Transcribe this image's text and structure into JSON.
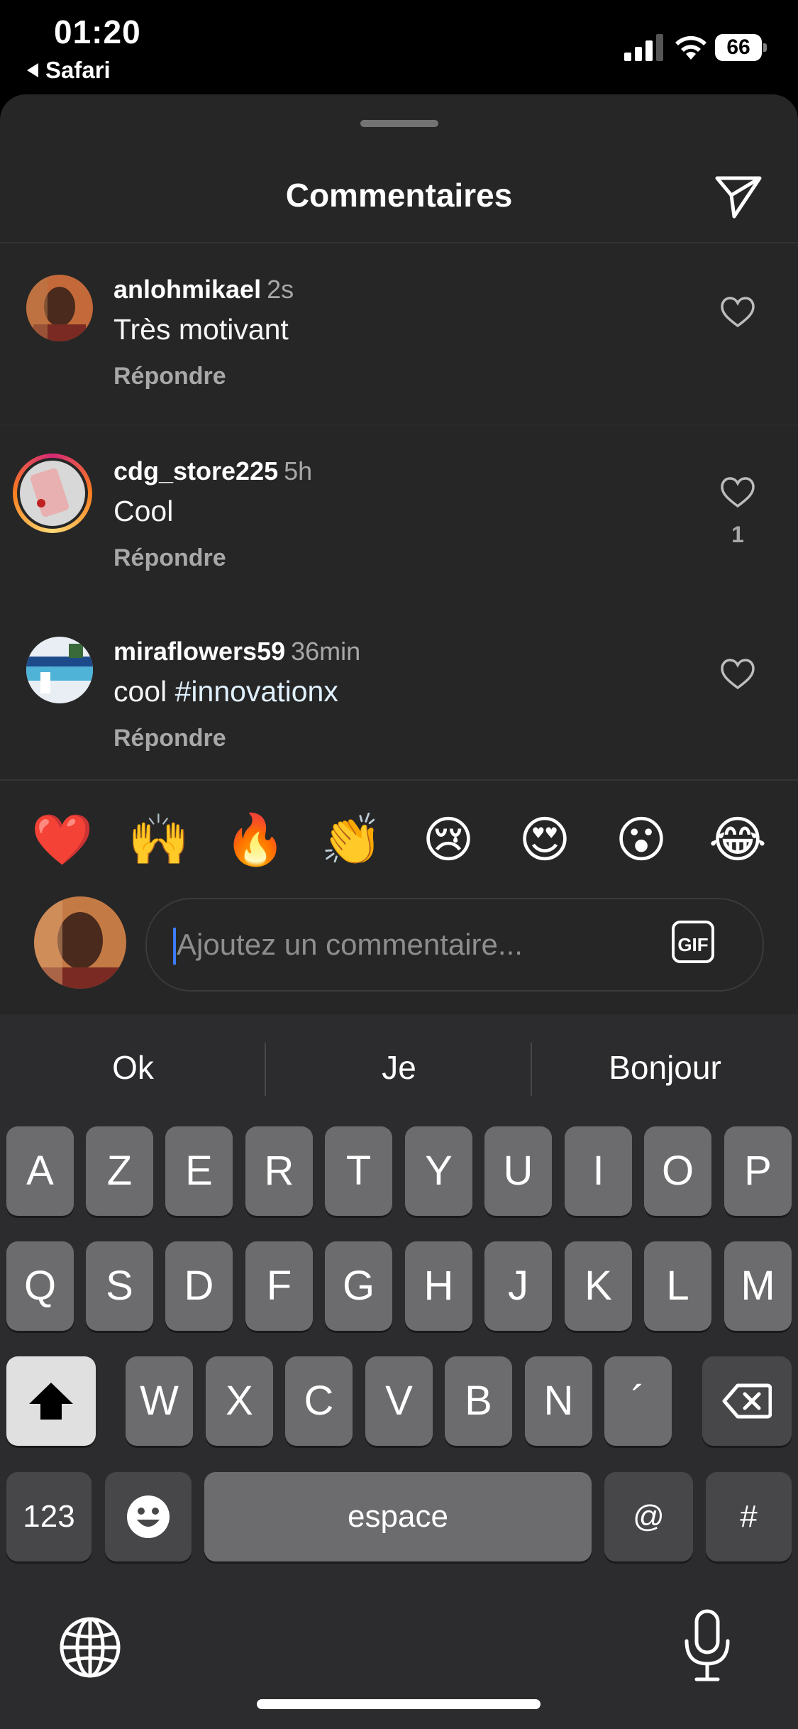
{
  "status_bar": {
    "time": "01:20",
    "back_app": "Safari",
    "battery": "66"
  },
  "sheet": {
    "title": "Commentaires"
  },
  "comments": [
    {
      "username": "anlohmikael",
      "time": "2s",
      "text": "Très motivant",
      "reply": "Répondre",
      "likes": ""
    },
    {
      "username": "cdg_store225",
      "time": "5h",
      "text": "Cool",
      "reply": "Répondre",
      "likes": "1"
    },
    {
      "username": "miraflowers59",
      "time": "36min",
      "text_prefix": "cool ",
      "hashtag": "#innovationx",
      "reply": "Répondre",
      "likes": ""
    }
  ],
  "quick_emojis": [
    "❤️",
    "🙌",
    "🔥",
    "👏",
    "😢",
    "😍",
    "😮",
    "😂"
  ],
  "composer": {
    "placeholder": "Ajoutez un commentaire...",
    "gif_label": "GIF"
  },
  "keyboard": {
    "suggestions": [
      "Ok",
      "Je",
      "Bonjour"
    ],
    "row1": [
      "A",
      "Z",
      "E",
      "R",
      "T",
      "Y",
      "U",
      "I",
      "O",
      "P"
    ],
    "row2": [
      "Q",
      "S",
      "D",
      "F",
      "G",
      "H",
      "J",
      "K",
      "L",
      "M"
    ],
    "row3": [
      "W",
      "X",
      "C",
      "V",
      "B",
      "N",
      "´"
    ],
    "numbers_label": "123",
    "space_label": "espace",
    "at_label": "@",
    "hash_label": "#"
  },
  "colors": {
    "sheet_bg": "#262626",
    "keyboard_bg": "#2c2c2e",
    "key_bg": "#6c6c6e",
    "secondary_text": "#a8a8a8",
    "caret": "#3d7bff"
  }
}
